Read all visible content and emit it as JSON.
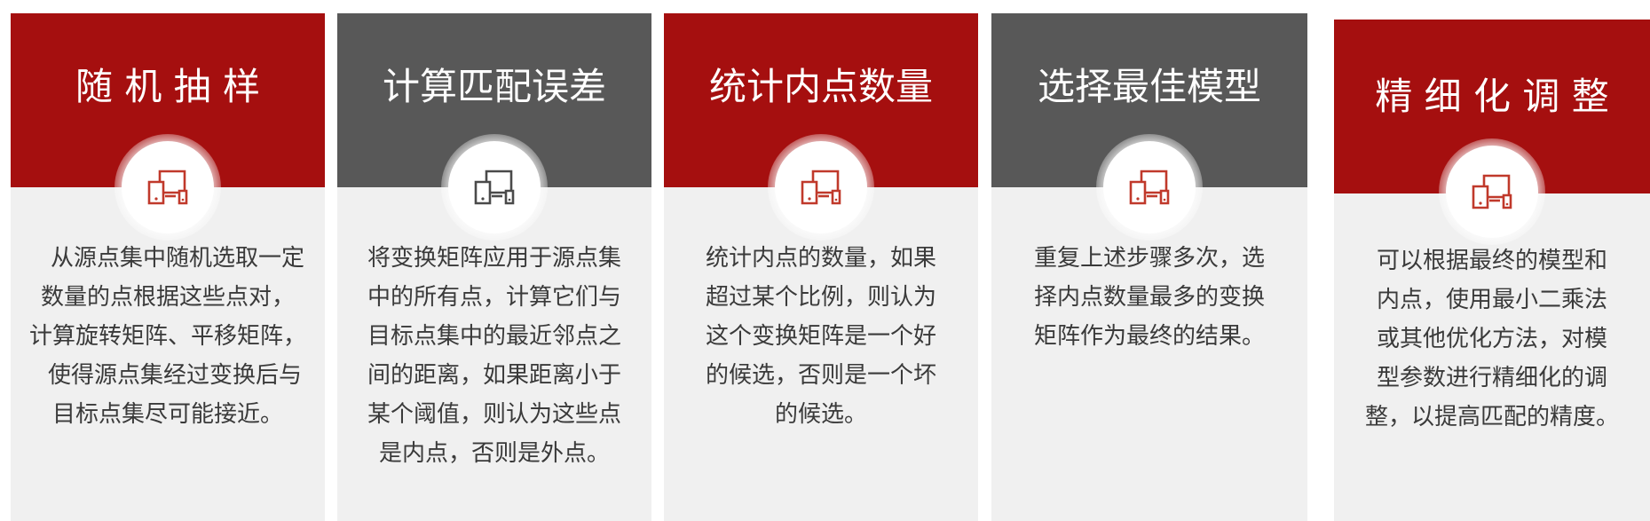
{
  "cards": [
    {
      "title": "随 机 抽 样",
      "header_color": "#a50f0f",
      "icon": "devices-icon",
      "lines": [
        "从源点集中随机选取一定",
        "数量的点根据这些点对，",
        "计算旋转矩阵、平移矩阵，",
        "使得源点集经过变换后与",
        "目标点集尽可能接近。"
      ]
    },
    {
      "title": "计算匹配误差",
      "header_color": "#585858",
      "icon": "devices-icon",
      "lines": [
        "将变换矩阵应用于源点集",
        "中的所有点，计算它们与",
        "目标点集中的最近邻点之",
        "间的距离，如果距离小于",
        "某个阈值，则认为这些点",
        "是内点，否则是外点。"
      ]
    },
    {
      "title": "统计内点数量",
      "header_color": "#a50f0f",
      "icon": "devices-icon",
      "lines": [
        "统计内点的数量，如果",
        "超过某个比例，则认为",
        "这个变换矩阵是一个好",
        "的候选，否则是一个坏",
        "的候选。"
      ]
    },
    {
      "title": "选择最佳模型",
      "header_color": "#585858",
      "icon": "devices-icon",
      "lines": [
        "重复上述步骤多次，选",
        "择内点数量最多的变换",
        "矩阵作为最终的结果。"
      ]
    },
    {
      "title": "精 细 化 调 整",
      "header_color": "#a50f0f",
      "icon": "devices-icon",
      "lines": [
        "可以根据最终的模型和",
        "内点，使用最小二乘法",
        "或其他优化方法，对模",
        "型参数进行精细化的调",
        "整，以提高匹配的精度。"
      ]
    }
  ],
  "colors": {
    "accent_red": "#a50f0f",
    "dark_gray": "#585858",
    "card_bg": "#f0f0f0",
    "text": "#3a3a3a",
    "icon": "#c0392b"
  }
}
